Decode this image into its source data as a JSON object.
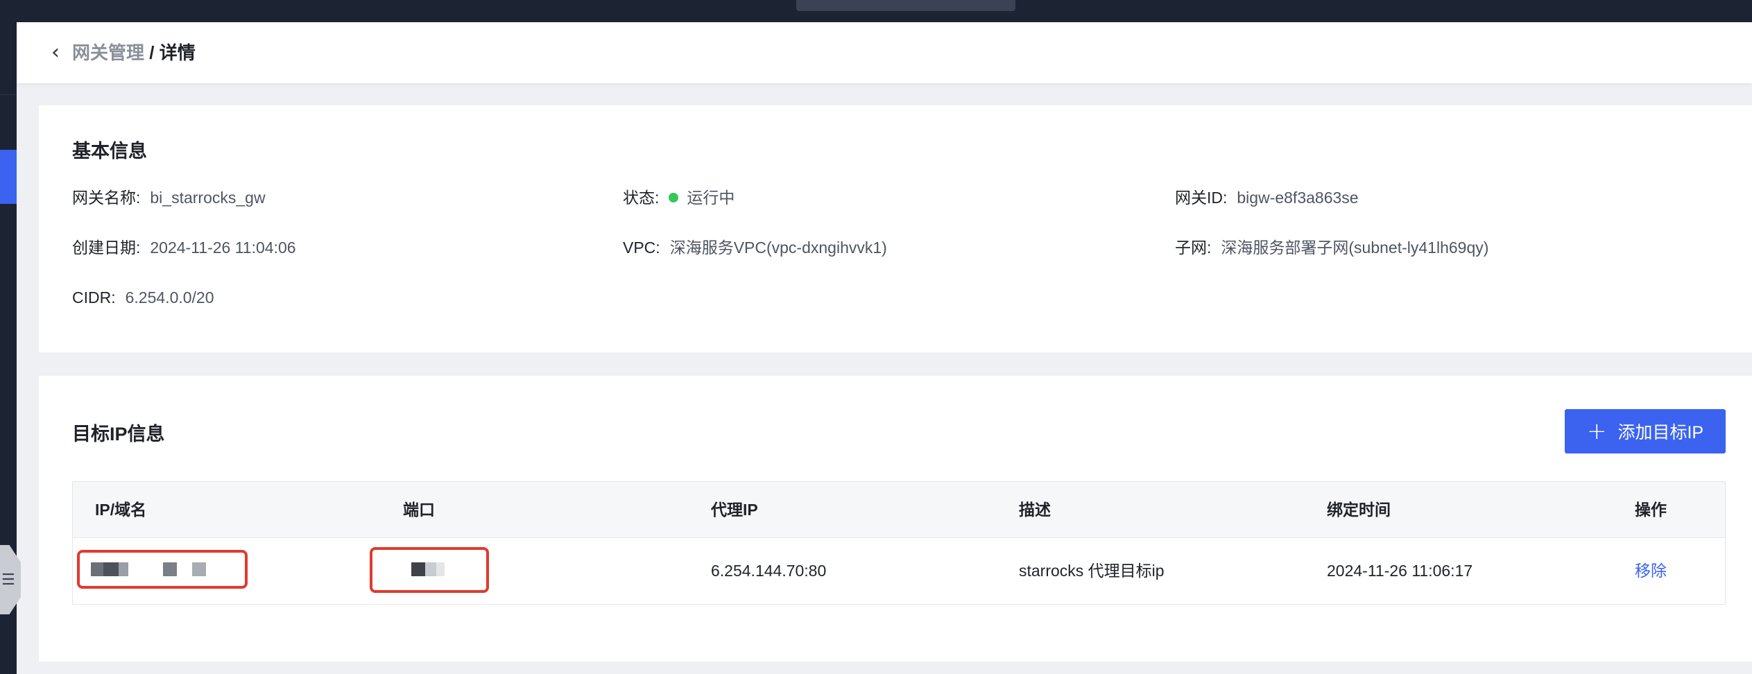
{
  "header": {
    "back_icon": "chevron-left-icon",
    "parent": "网关管理",
    "separator": " / ",
    "current": "详情"
  },
  "basic": {
    "title": "基本信息",
    "name_label": "网关名称:",
    "name_value": "bi_starrocks_gw",
    "status_label": "状态:",
    "status_value": "运行中",
    "status_color": "#34c759",
    "id_label": "网关ID:",
    "id_value": "bigw-e8f3a863se",
    "date_label": "创建日期:",
    "date_value": "2024-11-26 11:04:06",
    "vpc_label": "VPC:",
    "vpc_value": "深海服务VPC(vpc-dxngihvvk1)",
    "subnet_label": "子网:",
    "subnet_value": "深海服务部署子网(subnet-ly41lh69qy)",
    "cidr_label": "CIDR:",
    "cidr_value": "6.254.0.0/20"
  },
  "target": {
    "title": "目标IP信息",
    "add_button": "添加目标IP",
    "add_icon": "plus-icon",
    "columns": [
      "IP/域名",
      "端口",
      "代理IP",
      "描述",
      "绑定时间",
      "操作"
    ],
    "rows": [
      {
        "ip": "",
        "port": "",
        "proxy_ip": "6.254.144.70:80",
        "desc": "starrocks 代理目标ip",
        "bind_time": "2024-11-26 11:06:17",
        "action": "移除"
      }
    ]
  },
  "colors": {
    "accent": "#3b63f0",
    "highlight_box": "#e03a2e",
    "sidebar": "#1c2333"
  }
}
